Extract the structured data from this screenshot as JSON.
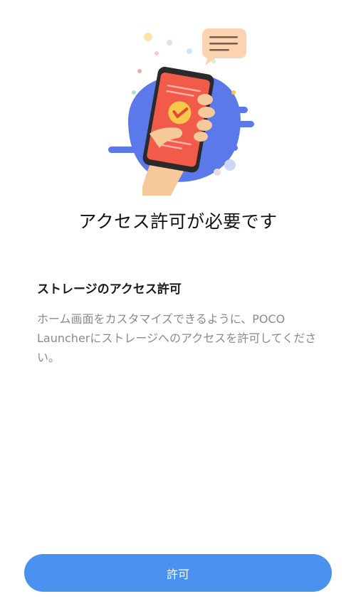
{
  "header": {
    "title": "アクセス許可が必要です"
  },
  "permission": {
    "heading": "ストレージのアクセス許可",
    "description": "ホーム画面をカスタマイズできるように、POCO Launcherにストレージへのアクセスを許可してください。"
  },
  "actions": {
    "allow_label": "許可"
  },
  "colors": {
    "accent": "#4a91f0",
    "phone_screen": "#f25a4a",
    "check_badge": "#f7c948",
    "blob": "#5b79e8",
    "speech_bubble": "#fbd3b0"
  },
  "illustration": {
    "icon": "phone-in-hand-checkmark-icon"
  }
}
